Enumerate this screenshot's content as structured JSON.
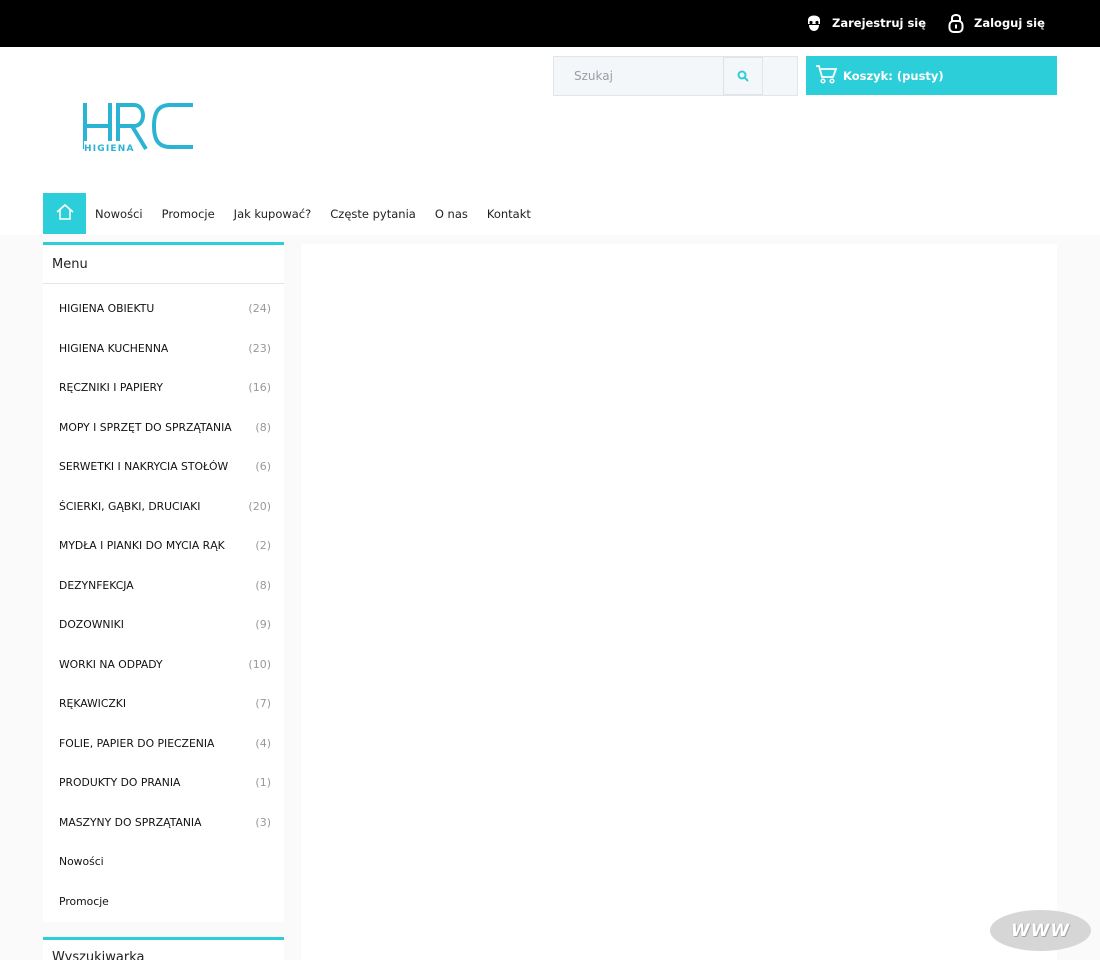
{
  "topbar": {
    "register_label": "Zarejestruj się",
    "login_label": "Zaloguj się"
  },
  "header": {
    "logo_text": "HRC",
    "logo_subtext": "HIGIENA",
    "search_placeholder": "Szukaj",
    "cart_label": "Koszyk: (pusty)"
  },
  "nav": {
    "items": [
      "Nowości",
      "Promocje",
      "Jak kupować?",
      "Częste pytania",
      "O nas",
      "Kontakt"
    ]
  },
  "sidebar": {
    "menu_title": "Menu",
    "items": [
      {
        "label": "HIGIENA OBIEKTU",
        "count": "(24)"
      },
      {
        "label": "HIGIENA KUCHENNA",
        "count": "(23)"
      },
      {
        "label": "RĘCZNIKI I PAPIERY",
        "count": "(16)"
      },
      {
        "label": "MOPY I SPRZĘT DO SPRZĄTANIA",
        "count": "(8)"
      },
      {
        "label": "SERWETKI I NAKRYCIA STOŁÓW",
        "count": "(6)"
      },
      {
        "label": "ŚCIERKI, GĄBKI, DRUCIAKI",
        "count": "(20)"
      },
      {
        "label": "MYDŁA I PIANKI DO MYCIA RĄK",
        "count": "(2)"
      },
      {
        "label": "DEZYNFEKCJA",
        "count": "(8)"
      },
      {
        "label": "DOZOWNIKI",
        "count": "(9)"
      },
      {
        "label": "WORKI NA ODPADY",
        "count": "(10)"
      },
      {
        "label": "RĘKAWICZKI",
        "count": "(7)"
      },
      {
        "label": "FOLIE, PAPIER DO PIECZENIA",
        "count": "(4)"
      },
      {
        "label": "PRODUKTY DO PRANIA",
        "count": "(1)"
      },
      {
        "label": "MASZYNY DO SPRZĄTANIA",
        "count": "(3)"
      },
      {
        "label": "Nowości",
        "count": ""
      },
      {
        "label": "Promocje",
        "count": ""
      }
    ],
    "search_title": "Wyszukiwarka"
  },
  "badge": {
    "text": "WWW"
  },
  "colors": {
    "accent": "#2ccfd9",
    "topbar": "#000000"
  },
  "icons": {
    "register": "user-glasses-icon",
    "login": "padlock-icon",
    "search": "magnifier-icon",
    "cart": "cart-icon",
    "home": "home-icon"
  }
}
